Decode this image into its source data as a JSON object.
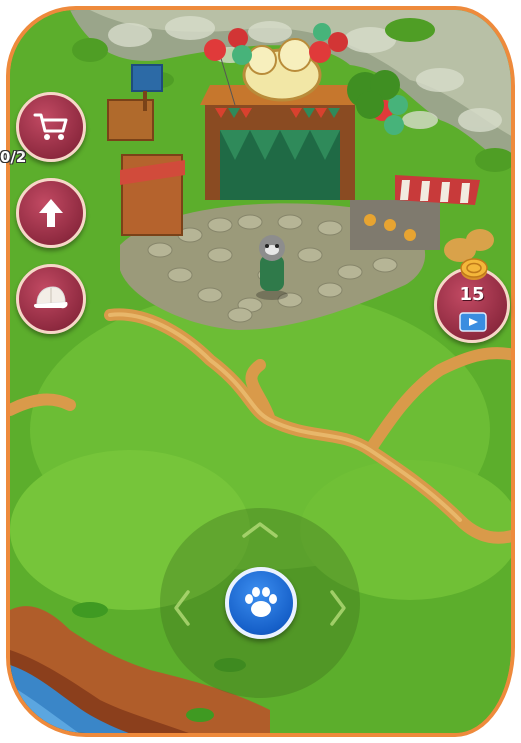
{
  "hud": {
    "quest_counter": "0/2",
    "tickets_count": "15"
  },
  "buttons": {
    "shop": "shop-cart",
    "upgrade": "up-arrow",
    "wardrobe": "cap"
  },
  "colors": {
    "frame": "#ee8a3c",
    "side_button": "#8f2a40",
    "paw_button": "#1660c9",
    "grass": "#5aa52a"
  }
}
